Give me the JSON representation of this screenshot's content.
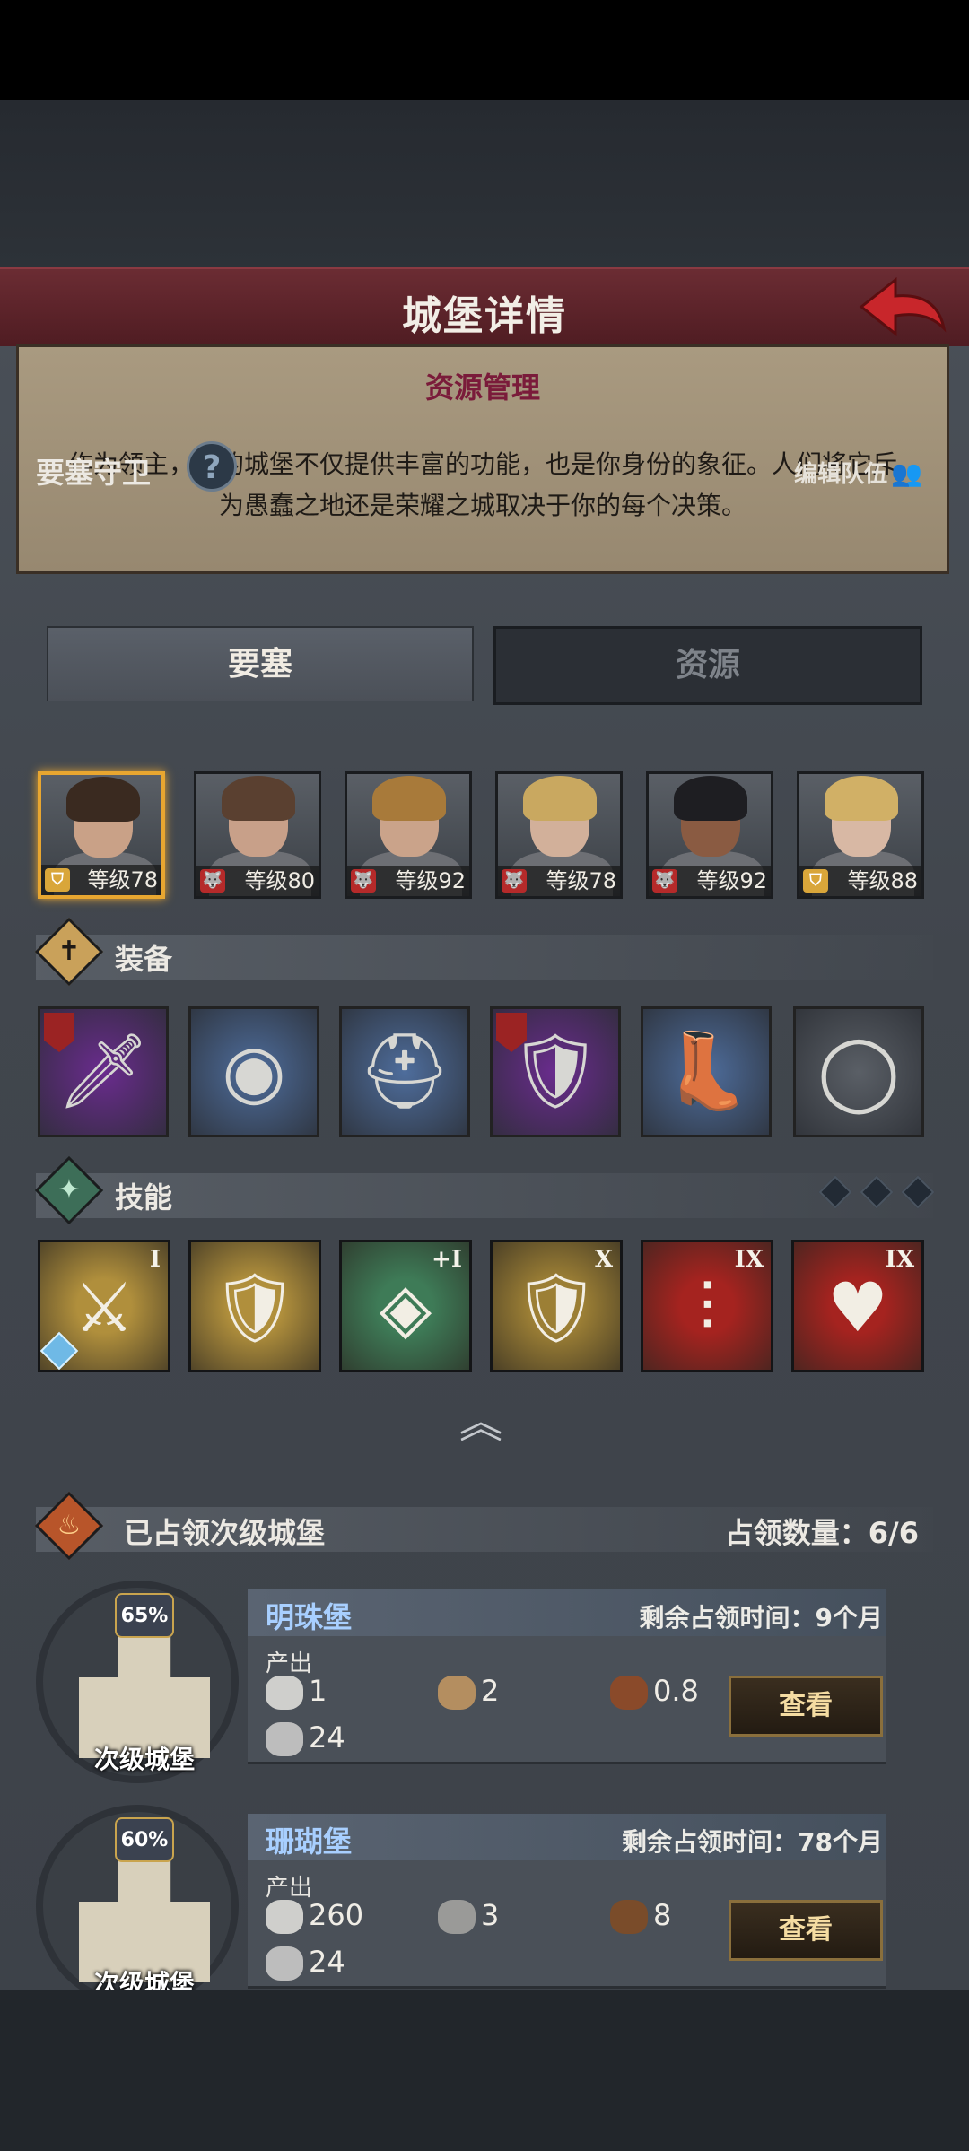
{
  "header": {
    "title": "城堡详情"
  },
  "intro": {
    "subtitle": "资源管理",
    "description": "作为领主，你的城堡不仅提供丰富的功能，也是你身份的象征。人们将它斥为愚蠢之地还是荣耀之城取决于你的每个决策。"
  },
  "tabs": [
    {
      "label": "要塞",
      "active": true
    },
    {
      "label": "资源",
      "active": false
    }
  ],
  "guards": {
    "title": "要塞守卫",
    "help_icon": "?",
    "edit_label": "编辑队伍",
    "heroes": [
      {
        "level_text": "等级78",
        "class_icon": "shield-icon",
        "selected": true,
        "hair": "#3a2a20",
        "skin": "#c9a187"
      },
      {
        "level_text": "等级80",
        "class_icon": "wolf-icon",
        "selected": false,
        "hair": "#5a4030",
        "skin": "#c8a089"
      },
      {
        "level_text": "等级92",
        "class_icon": "wolf-icon",
        "selected": false,
        "hair": "#a87a3a",
        "skin": "#caa38a"
      },
      {
        "level_text": "等级78",
        "class_icon": "wolf-icon",
        "selected": false,
        "hair": "#c9a860",
        "skin": "#d2b09a"
      },
      {
        "level_text": "等级92",
        "class_icon": "wolf-icon",
        "selected": false,
        "hair": "#1e1e22",
        "skin": "#8a5b42"
      },
      {
        "level_text": "等级88",
        "class_icon": "shield-icon",
        "selected": false,
        "hair": "#d1b066",
        "skin": "#d8b8a4"
      }
    ]
  },
  "equipment": {
    "title": "装备",
    "items": [
      {
        "name": "sword-icon",
        "glyph": "🗡",
        "rarity_color": "#6a2c8e",
        "flag": true
      },
      {
        "name": "round-shield-icon",
        "glyph": "◉",
        "rarity_color": "#4e6d9c",
        "flag": false
      },
      {
        "name": "helmet-icon",
        "glyph": "⛑",
        "rarity_color": "#4e6d9c",
        "flag": false
      },
      {
        "name": "armor-icon",
        "glyph": "🛡",
        "rarity_color": "#6a2c8e",
        "flag": true
      },
      {
        "name": "boots-icon",
        "glyph": "👢",
        "rarity_color": "#4e6d9c",
        "flag": false
      },
      {
        "name": "ring-icon",
        "glyph": "◯",
        "rarity_color": "#5a5f66",
        "flag": false
      }
    ]
  },
  "skills": {
    "title": "技能",
    "items": [
      {
        "name": "sword-shield-skill-icon",
        "glyph": "⚔",
        "rank": "I",
        "bg": "#b08f3c",
        "gem": true
      },
      {
        "name": "fortify-shield-skill-icon",
        "glyph": "🛡",
        "rank": "",
        "bg": "#b08f3c",
        "gem": false
      },
      {
        "name": "crystal-skill-icon",
        "glyph": "◈",
        "rank": "+I",
        "bg": "#3e7b57",
        "gem": false
      },
      {
        "name": "shield-skill-icon",
        "glyph": "🛡",
        "rank": "X",
        "bg": "#9c7f35",
        "gem": false
      },
      {
        "name": "strength-skill-icon",
        "glyph": "⫶",
        "rank": "IX",
        "bg": "#a5231f",
        "gem": false
      },
      {
        "name": "heart-skill-icon",
        "glyph": "♥",
        "rank": "IX",
        "bg": "#a5231f",
        "gem": false
      }
    ]
  },
  "occupied": {
    "title": "已占领次级城堡",
    "count_label": "占领数量：",
    "count_value": "6/6",
    "castles": [
      {
        "name": "明珠堡",
        "remaining_label": "剩余占领时间：",
        "remaining_value": "9个月",
        "percent": "65%",
        "type_label": "次级城堡",
        "output_label": "产出",
        "resources": [
          {
            "icon": "silver-icon",
            "value": "1"
          },
          {
            "icon": "grain-sack-icon",
            "value": "2"
          },
          {
            "icon": "goblet-icon",
            "value": "0.8"
          },
          {
            "icon": "population-icon",
            "value": "24"
          }
        ],
        "button_label": "查看"
      },
      {
        "name": "珊瑚堡",
        "remaining_label": "剩余占领时间：",
        "remaining_value": "78个月",
        "percent": "60%",
        "type_label": "次级城堡",
        "output_label": "产出",
        "resources": [
          {
            "icon": "silver-icon",
            "value": "260"
          },
          {
            "icon": "stone-icon",
            "value": "3"
          },
          {
            "icon": "wood-icon",
            "value": "8"
          },
          {
            "icon": "population-icon",
            "value": "24"
          }
        ],
        "button_label": "查看"
      }
    ]
  }
}
